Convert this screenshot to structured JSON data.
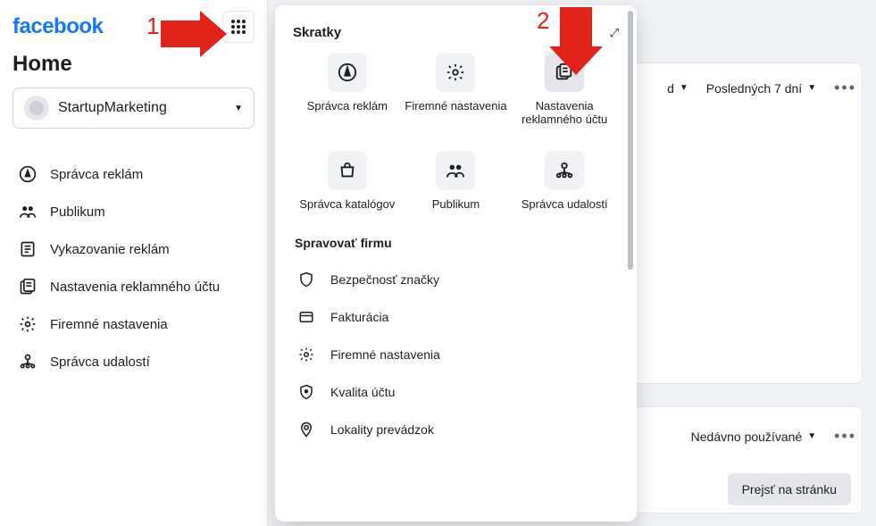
{
  "brand": "facebook",
  "page_title": "Home",
  "account_name": "StartupMarketing",
  "sidebar": {
    "items": [
      {
        "label": "Správca reklám",
        "icon": "compass"
      },
      {
        "label": "Publikum",
        "icon": "audience"
      },
      {
        "label": "Vykazovanie reklám",
        "icon": "report"
      },
      {
        "label": "Nastavenia reklamného účtu",
        "icon": "account-settings"
      },
      {
        "label": "Firemné nastavenia",
        "icon": "gear"
      },
      {
        "label": "Správca udalostí",
        "icon": "events"
      }
    ]
  },
  "popover": {
    "title": "Skratky",
    "shortcuts": [
      {
        "label": "Správca reklám",
        "icon": "compass"
      },
      {
        "label": "Firemné nastavenia",
        "icon": "gear"
      },
      {
        "label": "Nastavenia reklamného účtu",
        "icon": "account-settings"
      },
      {
        "label": "Správca katalógov",
        "icon": "catalog"
      },
      {
        "label": "Publikum",
        "icon": "audience"
      },
      {
        "label": "Správca udalostí",
        "icon": "events"
      }
    ],
    "section_title": "Spravovať firmu",
    "links": [
      {
        "label": "Bezpečnosť značky",
        "icon": "shield"
      },
      {
        "label": "Fakturácia",
        "icon": "billing"
      },
      {
        "label": "Firemné nastavenia",
        "icon": "gear"
      },
      {
        "label": "Kvalita účtu",
        "icon": "quality"
      },
      {
        "label": "Lokality prevádzok",
        "icon": "location"
      }
    ]
  },
  "background": {
    "dropdown_right_suffix": "d",
    "date_range": "Posledných 7 dní",
    "recent": "Nedávno používané",
    "goto_page": "Prejsť na stránku"
  },
  "annotations": {
    "one": "1",
    "two": "2"
  }
}
